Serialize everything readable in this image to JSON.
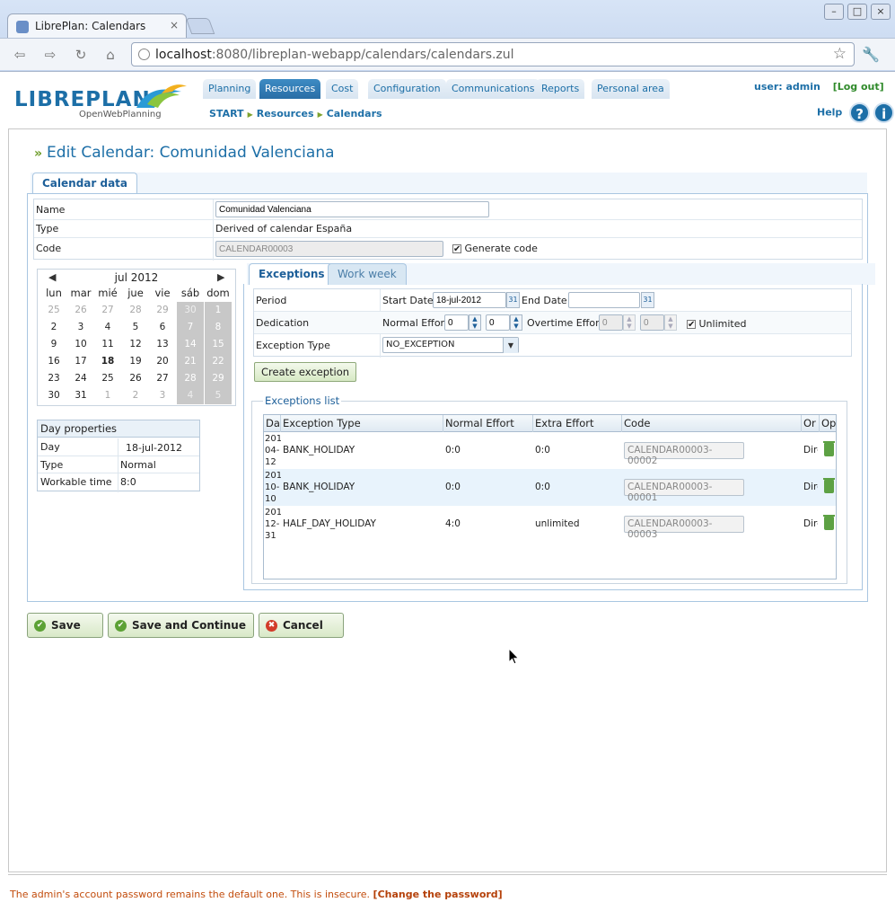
{
  "browser": {
    "tab_title": "LibrePlan: Calendars",
    "tab_close": "×",
    "url_host": "localhost",
    "url_rest": ":8080/libreplan-webapp/calendars/calendars.zul",
    "window_buttons": [
      "–",
      "□",
      "×"
    ]
  },
  "app": {
    "logo_text": "LIBREPLAN",
    "logo_tagline": "OpenWebPlanning",
    "nav": [
      "Planning",
      "Resources",
      "Cost",
      "Configuration",
      "Communications",
      "Reports",
      "Personal area"
    ],
    "nav_active": "Resources",
    "breadcrumb": [
      "START",
      "Resources",
      "Calendars"
    ],
    "user_label": "user: admin",
    "logout": "[Log out]",
    "help": "Help",
    "help_q": "?",
    "help_i": "i"
  },
  "page": {
    "title": "Edit Calendar: Comunidad Valenciana",
    "title_arrows": "»",
    "tab": "Calendar data",
    "fields": {
      "name_label": "Name",
      "name_value": "Comunidad Valenciana",
      "type_label": "Type",
      "type_value": "Derived of calendar España",
      "code_label": "Code",
      "code_value": "CALENDAR00003",
      "generate_code": "Generate code"
    }
  },
  "calendar": {
    "month": "jul 2012",
    "prev": "◀",
    "next": "▶",
    "weekdays": [
      "lun",
      "mar",
      "mié",
      "jue",
      "vie",
      "sáb",
      "dom"
    ],
    "weeks": [
      [
        "25",
        "26",
        "27",
        "28",
        "29",
        "30",
        "1"
      ],
      [
        "2",
        "3",
        "4",
        "5",
        "6",
        "7",
        "8"
      ],
      [
        "9",
        "10",
        "11",
        "12",
        "13",
        "14",
        "15"
      ],
      [
        "16",
        "17",
        "18",
        "19",
        "20",
        "21",
        "22"
      ],
      [
        "23",
        "24",
        "25",
        "26",
        "27",
        "28",
        "29"
      ],
      [
        "30",
        "31",
        "1",
        "2",
        "3",
        "4",
        "5"
      ]
    ],
    "selected_day": "18"
  },
  "day_properties": {
    "header": "Day properties",
    "rows": [
      {
        "label": "Day",
        "value": "18-jul-2012"
      },
      {
        "label": "Type",
        "value": "Normal"
      },
      {
        "label": "Workable time",
        "value": "8:0"
      }
    ]
  },
  "exceptions": {
    "tabs": [
      "Exceptions",
      "Work week"
    ],
    "period_label": "Period",
    "start_date_label": "Start Date:",
    "start_date_value": "18-jul-2012",
    "end_date_label": "End Date:",
    "end_date_value": "",
    "dedication_label": "Dedication",
    "normal_effort_label": "Normal Effort:",
    "normal_effort_h": "0",
    "normal_effort_m": "0",
    "overtime_effort_label": "Overtime Effort:",
    "overtime_effort_h": "0",
    "overtime_effort_m": "0",
    "unlimited_label": "Unlimited",
    "exception_type_label": "Exception Type",
    "exception_type_value": "NO_EXCEPTION",
    "create_button": "Create exception",
    "list_legend": "Exceptions list",
    "columns": [
      "Da",
      "Exception Type",
      "Normal Effort",
      "Extra Effort",
      "Code",
      "Or",
      "Op"
    ],
    "rows": [
      {
        "date_lines": [
          "201",
          "04-",
          "12"
        ],
        "type": "BANK_HOLIDAY",
        "normal": "0:0",
        "extra": "0:0",
        "code": "CALENDAR00003-00002",
        "origin": "Dire"
      },
      {
        "date_lines": [
          "201",
          "10-",
          "10"
        ],
        "type": "BANK_HOLIDAY",
        "normal": "0:0",
        "extra": "0:0",
        "code": "CALENDAR00003-00001",
        "origin": "Dire"
      },
      {
        "date_lines": [
          "201",
          "12-",
          "31"
        ],
        "type": "HALF_DAY_HOLIDAY",
        "normal": "4:0",
        "extra": "unlimited",
        "code": "CALENDAR00003-00003",
        "origin": "Dire"
      }
    ]
  },
  "actions": {
    "save": "Save",
    "save_continue": "Save and Continue",
    "cancel": "Cancel"
  },
  "footer": {
    "warning": "The admin's account password remains the default one. This is insecure.",
    "change_password": "[Change the password]"
  },
  "colors": {
    "brand": "#1d6fa7",
    "accent_green": "#6d9c28",
    "warning": "#c24c0c"
  }
}
